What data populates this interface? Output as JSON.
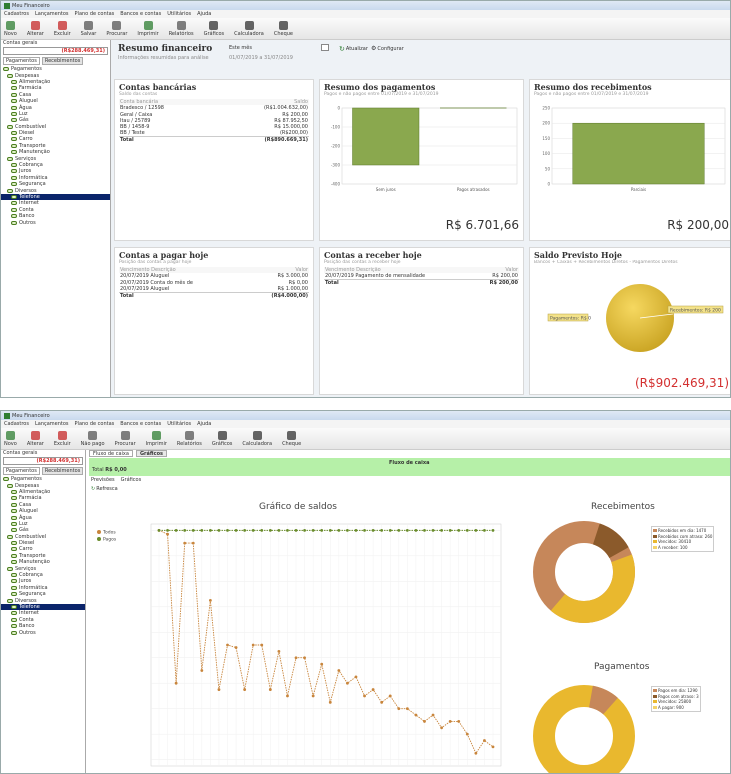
{
  "top": {
    "title": "Meu Financeiro",
    "menu": [
      "Cadastros",
      "Lançamentos",
      "Plano de contas",
      "Bancos e contas",
      "Utilitários",
      "Ajuda"
    ],
    "toolbar": [
      "Novo",
      "Alterar",
      "Excluir",
      "Salvar",
      "Procurar",
      "Imprimir",
      "Relatórios",
      "Gráficos",
      "Calculadora",
      "Cheque"
    ],
    "filter": {
      "label": "Contas gerais",
      "value": "(R$288.469,31)"
    },
    "tabs": [
      "Pagamentos",
      "Recebimentos"
    ],
    "tree": [
      "Pagamentos",
      "Despesas",
      "Alimentação",
      "Farmácia",
      "Casa",
      "Aluguel",
      "Água",
      "Luz",
      "Gás",
      "Combustível",
      "Diesel",
      "Carro",
      "Transporte",
      "Manutenção",
      "Serviços",
      "Cobrança",
      "Juros",
      "Informática",
      "Segurança",
      "Diversos",
      "Telefone",
      "Internet",
      "Conta",
      "Banco",
      "Outros"
    ],
    "tree_selected": 20,
    "header": {
      "title": "Resumo financeiro",
      "subtitle": "Informações resumidas para análise",
      "period_label": "Este mês",
      "period": "01/07/2019 a 31/07/2019",
      "refresh": "Atualizar",
      "configure": "Configurar"
    },
    "bank": {
      "title": "Contas bancárias",
      "subtitle": "Saldo das contas",
      "headers": [
        "Conta bancária",
        "Saldo"
      ],
      "rows": [
        [
          "Bradesco / 12598",
          "(R$1.004.632,00)"
        ],
        [
          "Geral / Caixa",
          "R$ 200,00"
        ],
        [
          "Itau / 25789",
          "R$ 87.952,50"
        ],
        [
          "BB / 1458-9",
          "R$ 15.000,00"
        ],
        [
          "BB / Teste",
          "(R$200,00)"
        ]
      ],
      "total": [
        "Total",
        "(R$890.669,31)"
      ]
    },
    "payments": {
      "title": "Resumo dos pagamentos",
      "subtitle": "Pagos e não pagos entre 01/07/2019 e 31/07/2019",
      "total": "R$ 6.701,66",
      "chart_data": {
        "type": "bar",
        "categories": [
          "Sem juros",
          "Pagos atrasados"
        ],
        "series": [
          {
            "values": [
              -300,
              0
            ]
          }
        ],
        "yticks": [
          "0",
          "-100",
          "-200",
          "-300",
          "-400"
        ],
        "ylim": [
          -400,
          0
        ]
      }
    },
    "receipts": {
      "title": "Resumo dos recebimentos",
      "subtitle": "Pagos e não pagos entre 01/07/2019 e 31/07/2019",
      "total": "R$ 200,00",
      "chart_data": {
        "type": "bar",
        "categories": [
          "Parciais"
        ],
        "series": [
          {
            "values": [
              200
            ]
          }
        ],
        "yticks": [
          "250",
          "200",
          "150",
          "100",
          "50",
          "0"
        ],
        "ylim": [
          0,
          250
        ]
      }
    },
    "topay": {
      "title": "Contas a pagar hoje",
      "subtitle": "Posição das contas a pagar hoje",
      "headers": [
        "Vencimento Descrição",
        "Valor"
      ],
      "rows": [
        [
          "20/07/2019 Aluguel",
          "R$ 3.000,00"
        ],
        [
          "20/07/2019 Conta do mês de",
          "R$ 0,00"
        ],
        [
          "20/07/2019 Aluguel",
          "R$ 1.000,00"
        ]
      ],
      "total": [
        "Total",
        "(R$4.000,00)"
      ]
    },
    "toreceive": {
      "title": "Contas a receber hoje",
      "subtitle": "Posição das contas a receber hoje",
      "headers": [
        "Vencimento Descrição",
        "Valor"
      ],
      "rows": [
        [
          "20/07/2019 Pagamento de mensalidade",
          "R$ 200,00"
        ]
      ],
      "total": [
        "Total",
        "R$ 200,00"
      ]
    },
    "forecast": {
      "title": "Saldo Previsto Hoje",
      "subtitle": "Bancos + Caixas + Recebimentos Diretos - Pagamentos Diretos",
      "total": "(R$902.469,31)",
      "pie_labels": [
        "Pagamentos: R$ 0",
        "Recebimentos: R$ 200"
      ]
    }
  },
  "bottom": {
    "title": "Meu Financeiro",
    "menu": [
      "Cadastros",
      "Lançamentos",
      "Plano de contas",
      "Bancos e contas",
      "Utilitários",
      "Ajuda"
    ],
    "toolbar": [
      "Novo",
      "Alterar",
      "Excluir",
      "Não pago",
      "Procurar",
      "Imprimir",
      "Relatórios",
      "Gráficos",
      "Calculadora",
      "Cheque"
    ],
    "tab": "Fluxo de caixa",
    "tab2": "Gráficos",
    "banner": "Fluxo de caixa",
    "total_label": "Total",
    "total": "R$ 0,00",
    "sub_tabs": [
      "Previsões",
      "Gráficos"
    ],
    "refresh": "Refresca",
    "chart_title": "Gráfico de saldos",
    "legend": [
      "Todos",
      "Pagos"
    ],
    "recebimentos": {
      "title": "Recebimentos",
      "legend": [
        "Recebidos em dia: 1470",
        "Recebidos com atraso: 260",
        "Vencidos: 30410",
        "A receber: 100"
      ]
    },
    "pagamentos": {
      "title": "Pagamentos",
      "legend": [
        "Pagos em dia: 1290",
        "Pagos com atraso: 3",
        "Vencidos: 25800",
        "A pagar: 900"
      ]
    },
    "chart_data": {
      "type": "line",
      "series": [
        {
          "name": "Todos",
          "values": [
            0,
            -30,
            -1200,
            -100,
            -100,
            -1100,
            -550,
            -1250,
            -900,
            -920,
            -1250,
            -900,
            -900,
            -1250,
            -950,
            -1300,
            -1000,
            -1000,
            -1300,
            -1050,
            -1350,
            -1100,
            -1200,
            -1150,
            -1300,
            -1250,
            -1350,
            -1300,
            -1400,
            -1400,
            -1450,
            -1500,
            -1450,
            -1550,
            -1500,
            -1500,
            -1600,
            -1750,
            -1650,
            -1700
          ]
        },
        {
          "name": "Pagos",
          "values": [
            0,
            0,
            0,
            0,
            0,
            0,
            0,
            0,
            0,
            0,
            0,
            0,
            0,
            0,
            0,
            0,
            0,
            0,
            0,
            0,
            0,
            0,
            0,
            0,
            0,
            0,
            0,
            0,
            0,
            0,
            0,
            0,
            0,
            0,
            0,
            0,
            0,
            0,
            0,
            0
          ]
        }
      ],
      "ylim": [
        -1850,
        50
      ]
    }
  }
}
